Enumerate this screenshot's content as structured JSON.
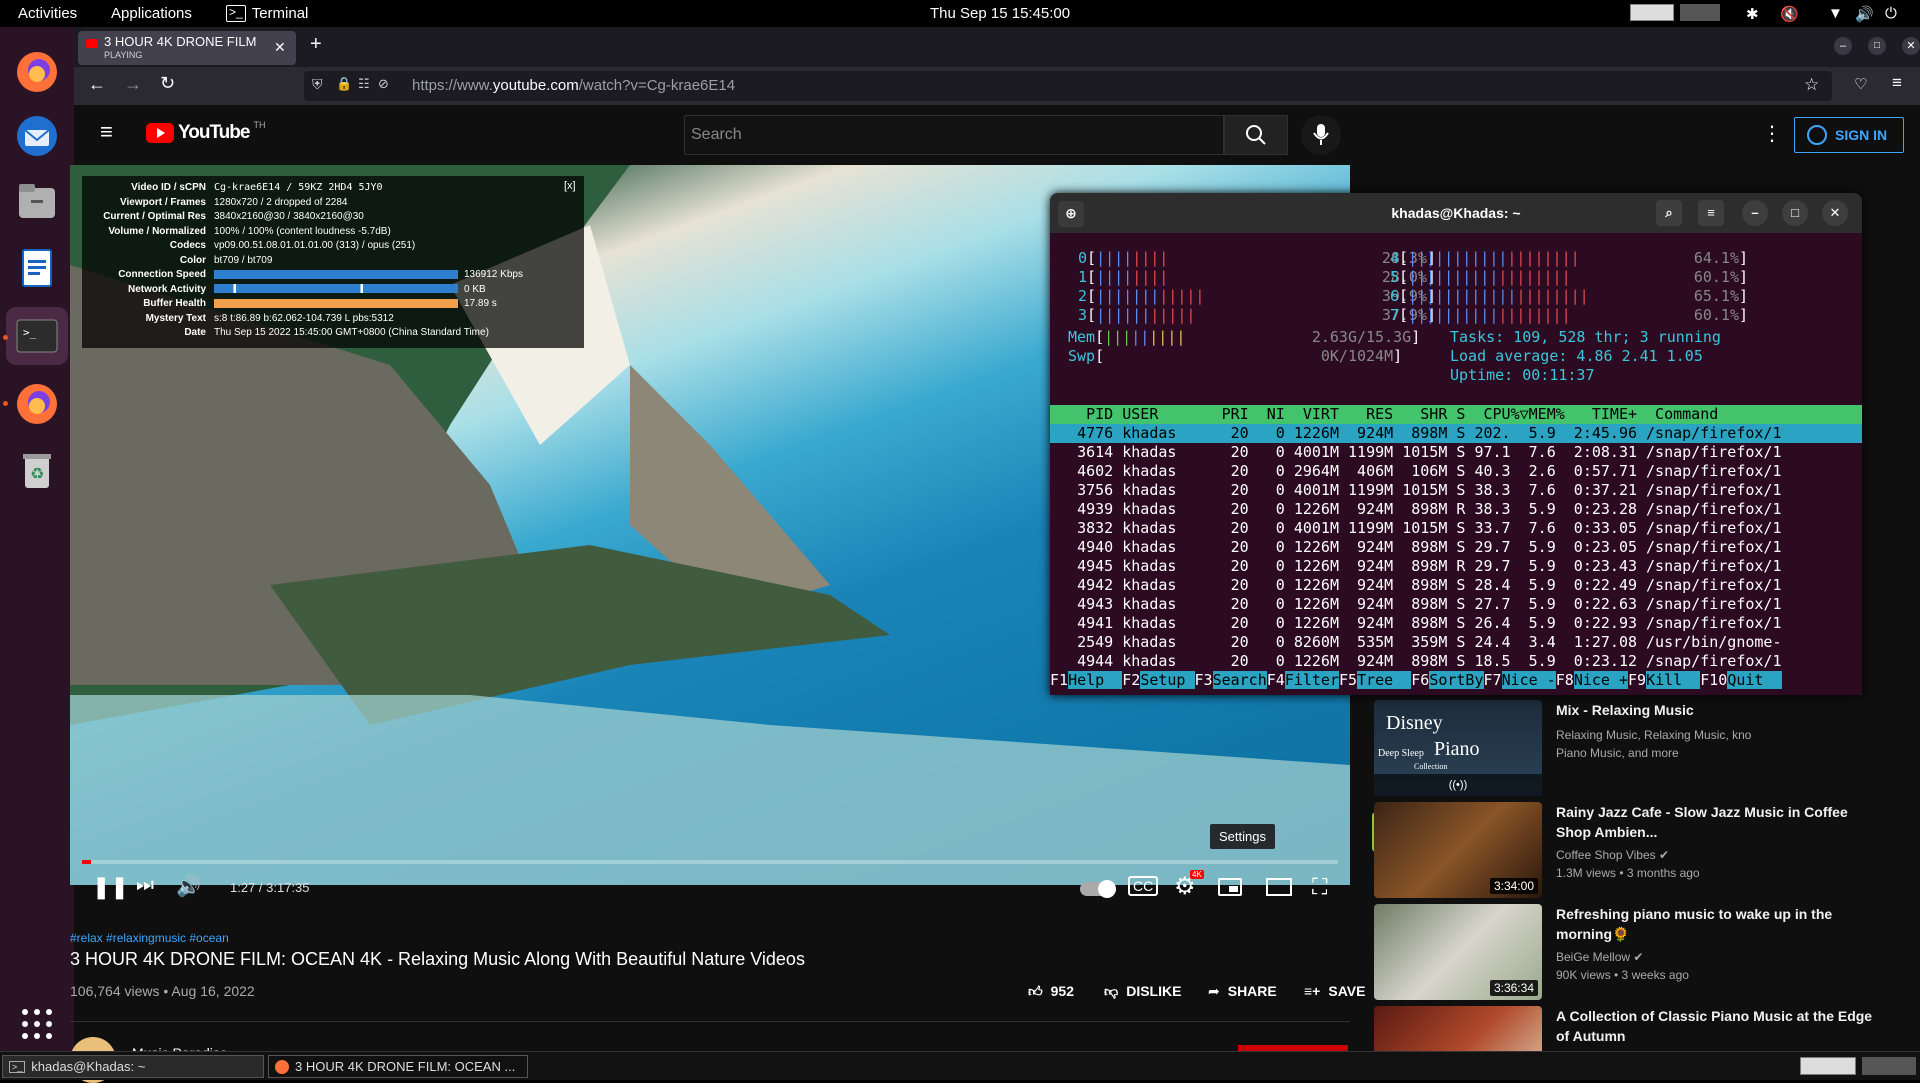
{
  "topbar": {
    "activities": "Activities",
    "applications": "Applications",
    "terminal": "Terminal",
    "clock": "Thu Sep 15  15:45:00"
  },
  "dock": {
    "items": [
      "firefox-icon",
      "thunderbird-icon",
      "files-icon",
      "writer-icon",
      "terminal-icon",
      "firefox-icon",
      "trash-icon"
    ]
  },
  "browser": {
    "tab_title": "3 HOUR 4K DRONE FILM",
    "tab_status": "PLAYING",
    "url_prefix": "https://www.",
    "url_domain": "youtube.com",
    "url_rest": "/watch?v=Cg-krae6E14"
  },
  "youtube": {
    "logo": "YouTube",
    "logo_sup": "TH",
    "search_placeholder": "Search",
    "sign_in": "SIGN IN"
  },
  "stats": {
    "close": "[x]",
    "rows": [
      {
        "k": "Video ID / sCPN",
        "v": "Cg-krae6E14  /  59KZ 2HD4 5JY0"
      },
      {
        "k": "Viewport / Frames",
        "v": "1280x720 / 2 dropped of 2284"
      },
      {
        "k": "Current / Optimal Res",
        "v": "3840x2160@30 / 3840x2160@30"
      },
      {
        "k": "Volume / Normalized",
        "v": "100% / 100% (content loudness -5.7dB)"
      },
      {
        "k": "Codecs",
        "v": "vp09.00.51.08.01.01.01.00 (313) / opus (251)"
      },
      {
        "k": "Color",
        "v": "bt709 / bt709"
      },
      {
        "k": "Connection Speed",
        "v": "136912 Kbps"
      },
      {
        "k": "Network Activity",
        "v": "0 KB"
      },
      {
        "k": "Buffer Health",
        "v": "17.89 s"
      },
      {
        "k": "Mystery Text",
        "v": "s:8 t:86.89 b:62.062-104.739 L pbs:5312"
      },
      {
        "k": "Date",
        "v": "Thu Sep 15 2022 15:45:00 GMT+0800 (China Standard Time)"
      }
    ]
  },
  "player": {
    "time": "1:27 / 3:17:35",
    "settings_tooltip": "Settings",
    "progress": 0.007
  },
  "video": {
    "hashtags": "#relax #relaxingmusic #ocean",
    "title": "3 HOUR 4K DRONE FILM: OCEAN 4K - Relaxing Music Along With Beautiful Nature Videos",
    "views": "106,764 views • Aug 16, 2022",
    "likes": "952",
    "dislike": "DISLIKE",
    "share": "SHARE",
    "save": "SAVE",
    "channel": "Music Paradise"
  },
  "recs": [
    {
      "title": "Mix - Relaxing Music",
      "sub1": "Relaxing Music, Relaxing Music, kno",
      "sub2": "Piano Music, and more",
      "thumb_text": "Disney",
      "thumb_text2": "Piano",
      "thumb_small": "Deep Sleep",
      "thumb_small2": "Collection"
    },
    {
      "title": "Rainy Jazz Cafe - Slow Jazz Music in Coffee Shop Ambien...",
      "sub1": "Coffee Shop Vibes ✔",
      "sub2": "1.3M views • 3 months ago",
      "duration": "3:34:00"
    },
    {
      "title": "Refreshing piano music to wake up in the morning🌻",
      "sub1": "BeiGe Mellow ✔",
      "sub2": "90K views • 3 weeks ago",
      "duration": "3:36:34"
    },
    {
      "title": "A Collection of Classic Piano Music at the Edge of Autumn",
      "sub1": "",
      "sub2": ""
    }
  ],
  "terminal": {
    "title": "khadas@Khadas: ~",
    "cpus": [
      {
        "label": "0",
        "pct": "28.3%"
      },
      {
        "label": "1",
        "pct": "28.0%"
      },
      {
        "label": "2",
        "pct": "39.9%"
      },
      {
        "label": "3",
        "pct": "37.9%"
      },
      {
        "label": "4",
        "pct": "64.1%"
      },
      {
        "label": "5",
        "pct": "60.1%"
      },
      {
        "label": "6",
        "pct": "65.1%"
      },
      {
        "label": "7",
        "pct": "60.1%"
      }
    ],
    "mem": "2.63G/15.3G",
    "swp": "0K/1024M",
    "tasks": "Tasks: 109, 528 thr; 3 running",
    "load": "Load average: 4.86 2.41 1.05",
    "uptime": "Uptime: 00:11:37",
    "header": "    PID USER       PRI  NI  VIRT   RES   SHR S  CPU%▽MEM%   TIME+  Command",
    "rows": [
      "   4776 khadas      20   0 1226M  924M  898M S 202.  5.9  2:45.96 /snap/firefox/1",
      "   3614 khadas      20   0 4001M 1199M 1015M S 97.1  7.6  2:08.31 /snap/firefox/1",
      "   4602 khadas      20   0 2964M  406M  106M S 40.3  2.6  0:57.71 /snap/firefox/1",
      "   3756 khadas      20   0 4001M 1199M 1015M S 38.3  7.6  0:37.21 /snap/firefox/1",
      "   4939 khadas      20   0 1226M  924M  898M R 38.3  5.9  0:23.28 /snap/firefox/1",
      "   3832 khadas      20   0 4001M 1199M 1015M S 33.7  7.6  0:33.05 /snap/firefox/1",
      "   4940 khadas      20   0 1226M  924M  898M S 29.7  5.9  0:23.05 /snap/firefox/1",
      "   4945 khadas      20   0 1226M  924M  898M R 29.7  5.9  0:23.43 /snap/firefox/1",
      "   4942 khadas      20   0 1226M  924M  898M S 28.4  5.9  0:22.49 /snap/firefox/1",
      "   4943 khadas      20   0 1226M  924M  898M S 27.7  5.9  0:22.63 /snap/firefox/1",
      "   4941 khadas      20   0 1226M  924M  898M S 26.4  5.9  0:22.93 /snap/firefox/1",
      "   2549 khadas      20   0 8260M  535M  359M S 24.4  3.4  1:27.08 /usr/bin/gnome-",
      "   4944 khadas      20   0 1226M  924M  898M S 18.5  5.9  0:23.12 /snap/firefox/1"
    ],
    "fkeys": [
      {
        "k": "F1",
        "l": "Help  "
      },
      {
        "k": "F2",
        "l": "Setup "
      },
      {
        "k": "F3",
        "l": "Search"
      },
      {
        "k": "F4",
        "l": "Filter"
      },
      {
        "k": "F5",
        "l": "Tree  "
      },
      {
        "k": "F6",
        "l": "SortBy"
      },
      {
        "k": "F7",
        "l": "Nice -"
      },
      {
        "k": "F8",
        "l": "Nice +"
      },
      {
        "k": "F9",
        "l": "Kill  "
      },
      {
        "k": "F10",
        "l": "Quit  "
      }
    ]
  },
  "taskbar": {
    "items": [
      "khadas@Khadas: ~",
      "3 HOUR 4K DRONE FILM: OCEAN ..."
    ]
  }
}
